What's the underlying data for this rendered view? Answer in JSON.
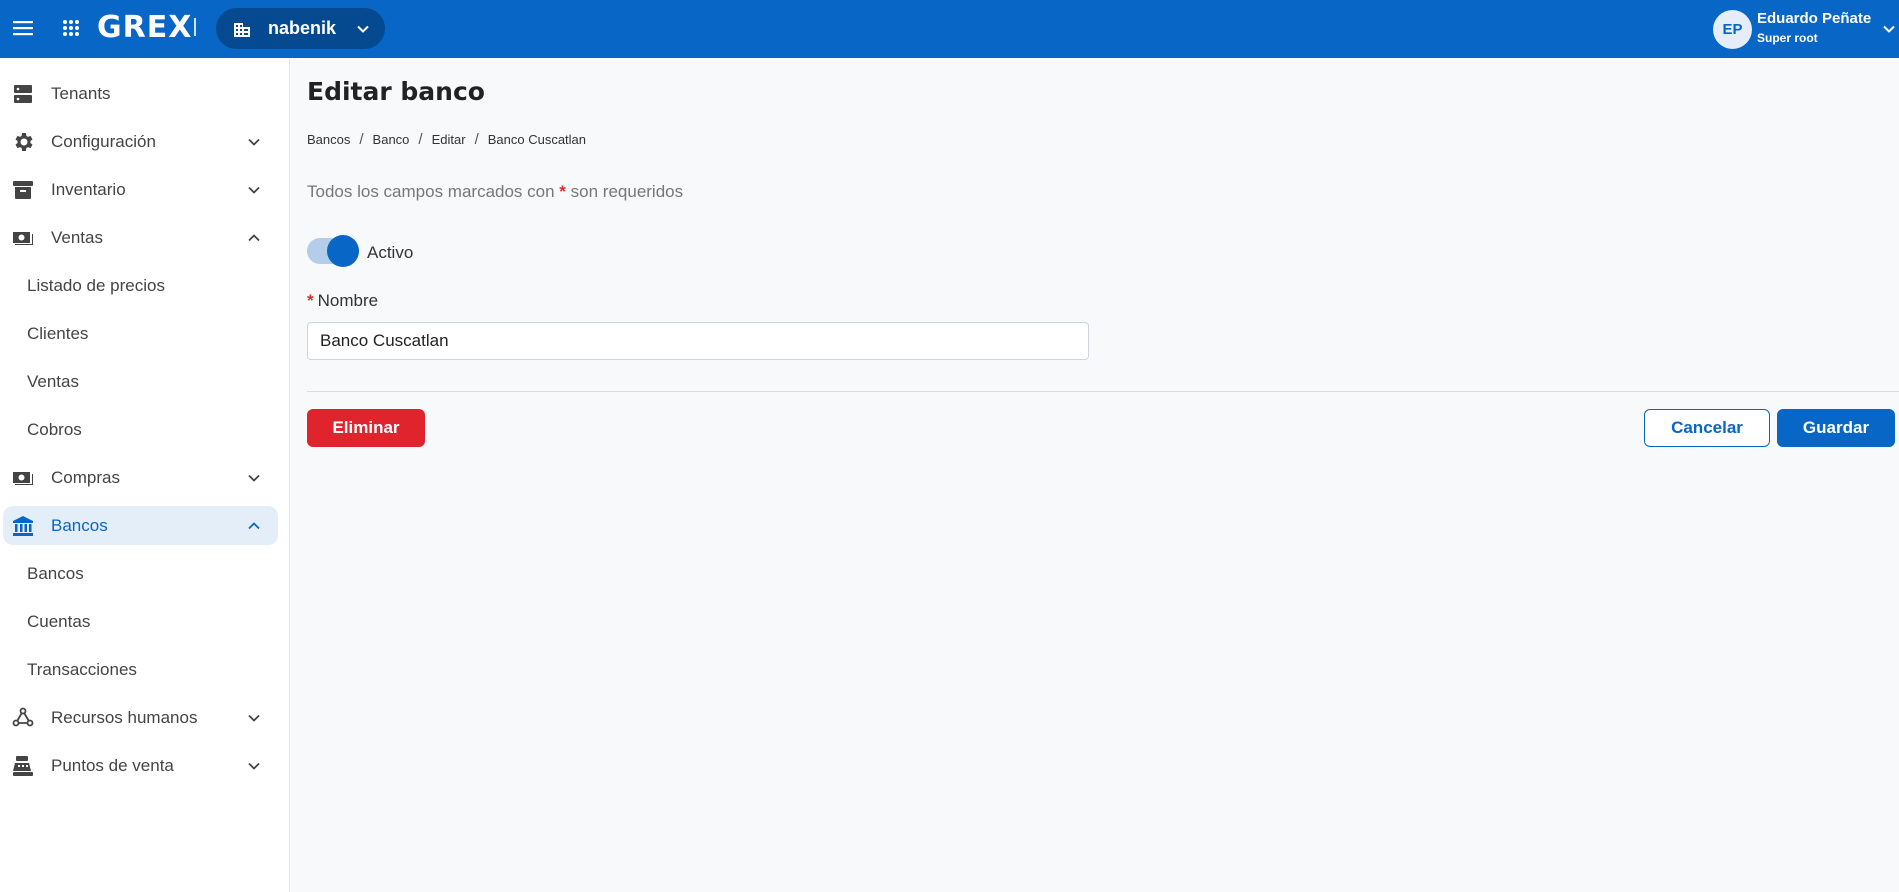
{
  "topbar": {
    "logo": "GREX",
    "tenant": "nabenik",
    "user": {
      "initials": "EP",
      "name": "Eduardo Peñate",
      "role": "Super root"
    }
  },
  "sidebar": {
    "items": [
      {
        "label": "Tenants",
        "icon": "server-icon"
      },
      {
        "label": "Configuración",
        "icon": "gear-icon",
        "chevron": "down"
      },
      {
        "label": "Inventario",
        "icon": "archive-box-icon",
        "chevron": "down"
      },
      {
        "label": "Ventas",
        "icon": "cash-icon",
        "chevron": "up"
      },
      {
        "label": "Compras",
        "icon": "cash-icon",
        "chevron": "down"
      },
      {
        "label": "Bancos",
        "icon": "bank-icon",
        "chevron": "up",
        "active": true
      },
      {
        "label": "Recursos humanos",
        "icon": "people-network-icon",
        "chevron": "down"
      },
      {
        "label": "Puntos de venta",
        "icon": "cash-register-icon",
        "chevron": "down"
      }
    ],
    "ventas_sub": [
      "Listado de precios",
      "Clientes",
      "Ventas",
      "Cobros"
    ],
    "bancos_sub": [
      "Bancos",
      "Cuentas",
      "Transacciones"
    ]
  },
  "main": {
    "title": "Editar banco",
    "breadcrumb": [
      "Bancos",
      "Banco",
      "Editar",
      "Banco Cuscatlan"
    ],
    "required_note_before": "Todos los campos marcados con",
    "required_star": "*",
    "required_note_after": "son requeridos",
    "toggle": {
      "label": "Activo",
      "on": true
    },
    "name_field": {
      "label": "Nombre",
      "value": "Banco Cuscatlan"
    },
    "buttons": {
      "delete": "Eliminar",
      "cancel": "Cancelar",
      "save": "Guardar"
    }
  },
  "colors": {
    "primary": "#0866c6",
    "danger": "#e0242e",
    "active_bg": "#e4eef9",
    "main_bg": "#f8f9fa"
  }
}
